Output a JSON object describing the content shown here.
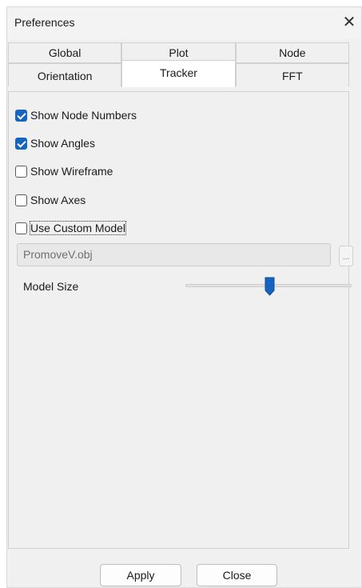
{
  "window": {
    "title": "Preferences",
    "close_glyph": "✕"
  },
  "tabs": {
    "back_row": [
      {
        "label": "Global"
      },
      {
        "label": "Plot"
      },
      {
        "label": "Node"
      }
    ],
    "front_row": [
      {
        "label": "Orientation"
      },
      {
        "label": "Tracker",
        "active": true
      },
      {
        "label": "FFT"
      }
    ]
  },
  "tracker": {
    "options": [
      {
        "label": "Show Node Numbers",
        "checked": true
      },
      {
        "label": "Show Angles",
        "checked": true
      },
      {
        "label": "Show Wireframe",
        "checked": false
      },
      {
        "label": "Show Axes",
        "checked": false
      },
      {
        "label": "Use Custom Model",
        "checked": false
      }
    ],
    "model_file": {
      "value": "PromoveV.obj",
      "browse_label": "..."
    },
    "model_size": {
      "label": "Model Size",
      "level": 0.5
    }
  },
  "buttons": {
    "apply": "Apply",
    "close": "Close"
  },
  "colors": {
    "accent": "#1565c0"
  }
}
